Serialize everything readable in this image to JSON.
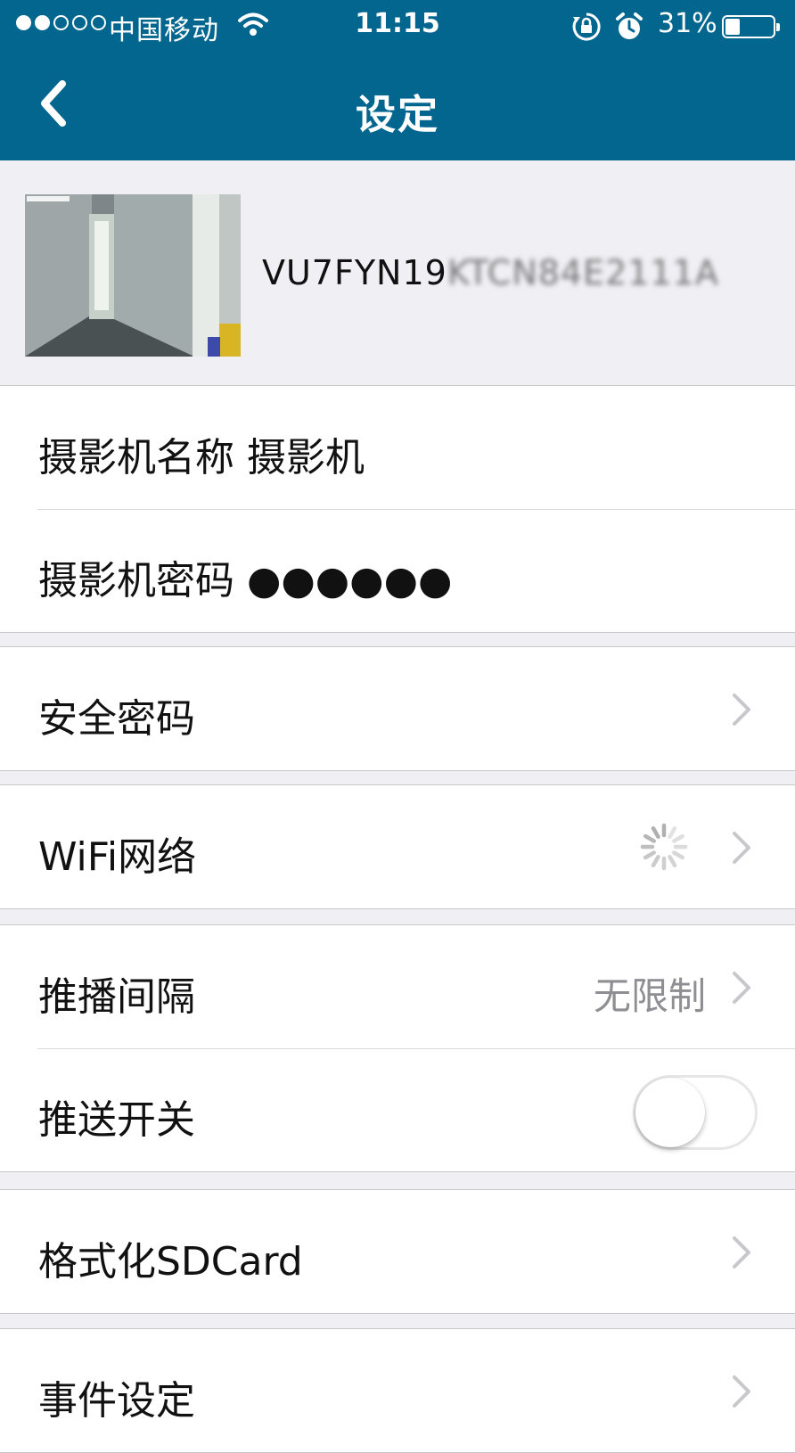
{
  "status_bar": {
    "carrier": "中国移动",
    "time": "11:15",
    "battery": "31%",
    "battery_level": 0.31,
    "signal_bars_filled": 2,
    "signal_bars_total": 5
  },
  "nav": {
    "title": "设定",
    "back_icon": "chevron-left-icon"
  },
  "camera": {
    "id_visible": "VU7FYN19",
    "id_obscured": "KTCN84E2111A"
  },
  "groups": [
    {
      "rows": [
        {
          "label": "摄影机名称",
          "value": "摄影机"
        },
        {
          "label": "摄影机密码",
          "value": "●●●●●●"
        }
      ]
    },
    {
      "rows": [
        {
          "label": "安全密码"
        }
      ]
    },
    {
      "rows": [
        {
          "label": "WiFi网络",
          "status_icon": "loading-spinner-icon"
        }
      ]
    },
    {
      "rows": [
        {
          "label": "推播间隔",
          "value": "无限制"
        },
        {
          "label": "推送开关",
          "toggle_on": false
        }
      ]
    },
    {
      "rows": [
        {
          "label": "格式化SDCard"
        }
      ]
    },
    {
      "rows": [
        {
          "label": "事件设定"
        }
      ]
    }
  ],
  "colors": {
    "nav_background": "#03668f",
    "page_background": "#efeff4",
    "secondary_text": "#8e8e93",
    "chevron": "#c7c7cc"
  }
}
